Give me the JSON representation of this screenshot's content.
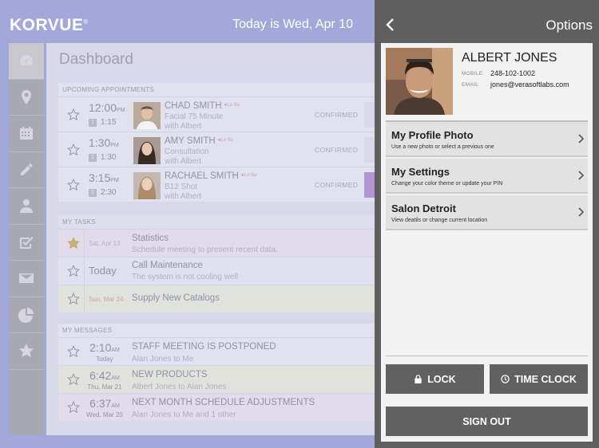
{
  "app": {
    "logo": "KORVUE",
    "logo_mark": "®",
    "date_text": "Today is Wed, Apr 10",
    "page_title": "Dashboard"
  },
  "sidebar": {
    "items": [
      "dashboard",
      "location",
      "calendar",
      "edit",
      "person",
      "tasks",
      "messages",
      "reports",
      "favorites"
    ]
  },
  "appointments": {
    "title": "UPCOMING APPOINTMENTS",
    "items": [
      {
        "time": "12:00",
        "ampm": "PM",
        "num": "1",
        "dur": "1:15",
        "name": "CHAD SMITH",
        "tag": "●Lo Su",
        "service": "Facial 75 Minute",
        "with": "with Albert",
        "status": "CONFIRMED"
      },
      {
        "time": "1:30",
        "ampm": "PM",
        "num": "2",
        "dur": "1:30",
        "name": "AMY SMITH",
        "tag": "●Lo Su",
        "service": "Consultation",
        "with": "with Albert",
        "status": "CONFIRMED"
      },
      {
        "time": "3:15",
        "ampm": "PM",
        "num": "2",
        "dur": "2:30",
        "name": "RACHAEL SMITH",
        "tag": "●Lo Su",
        "service": "B12 Shot",
        "with": "with Albert",
        "status": "CONFIRMED"
      }
    ]
  },
  "tasks": {
    "title": "MY TASKS",
    "items": [
      {
        "date": "Sat, Apr 13",
        "title": "Statistics",
        "sub": "Schedule meeting to present recent data.",
        "starred": true
      },
      {
        "date": "Today",
        "title": "Call Maintenance",
        "sub": "The system is not cooling well",
        "starred": false
      },
      {
        "date": "Sun, Mar 24",
        "title": "Supply New Catalogs",
        "sub": "",
        "starred": false
      }
    ]
  },
  "messages": {
    "title": "MY MESSAGES",
    "items": [
      {
        "time": "2:10",
        "ampm": "AM",
        "day": "Today",
        "title": "STAFF MEETING IS POSTPONED",
        "sub": "Alan Jones to Me"
      },
      {
        "time": "6:42",
        "ampm": "AM",
        "day": "Thu, Mar 21",
        "title": "NEW PRODUCTS",
        "sub": "Albert Jones to Alan Jones"
      },
      {
        "time": "6:37",
        "ampm": "AM",
        "day": "Wed, Mar 20",
        "title": "NEXT MONTH SCHEDULE ADJUSTMENTS",
        "sub": "Alan Jones to Me and 1 other"
      }
    ]
  },
  "options": {
    "title": "Options",
    "profile": {
      "name": "ALBERT JONES",
      "mobile_label": "MOBILE",
      "mobile": "248-102-1002",
      "email_label": "EMAIL",
      "email": "jones@verasoftlabs.com"
    },
    "menu": [
      {
        "title": "My Profile Photo",
        "sub": "Use a new photo or select a previous one"
      },
      {
        "title": "My Settings",
        "sub": "Change your color theme or update your PIN"
      },
      {
        "title": "Salon Detroit",
        "sub": "View deatils or change current location"
      }
    ],
    "lock_label": "LOCK",
    "time_clock_label": "TIME CLOCK",
    "sign_out_label": "SIGN OUT"
  },
  "colors": {
    "overlay": "#a3a8db",
    "panel_dark": "#5f5f5f",
    "button": "#616161",
    "star_gold": "#e6c64a"
  }
}
